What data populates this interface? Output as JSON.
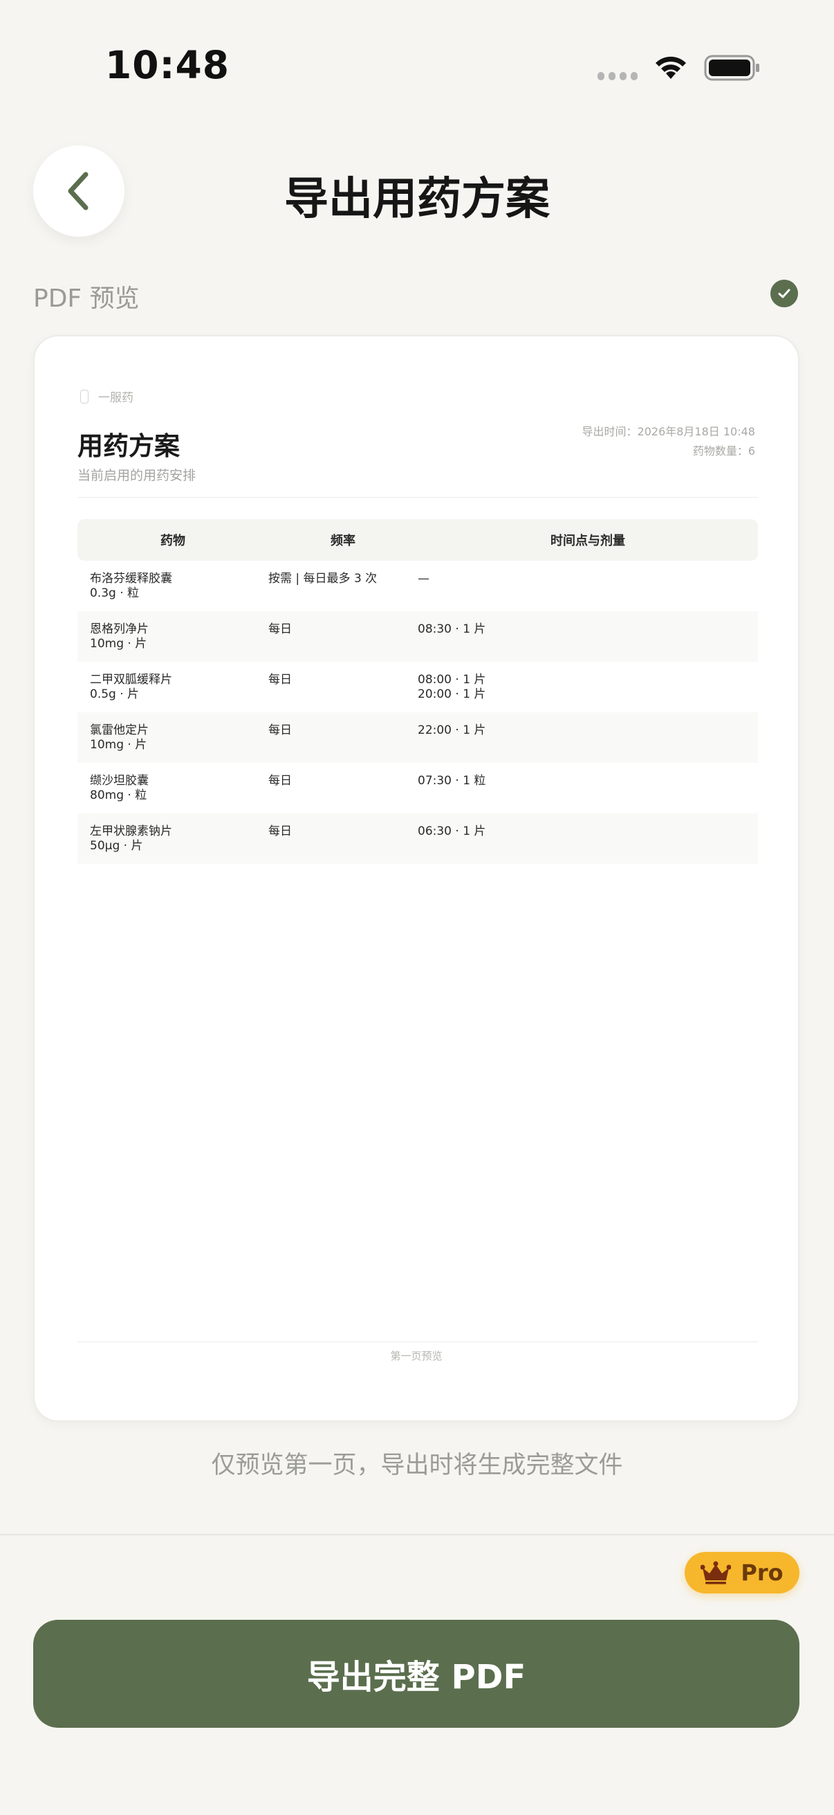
{
  "status_bar": {
    "time": "10:48"
  },
  "header": {
    "title": "导出用药方案",
    "back_icon": "chevron-left-icon"
  },
  "section": {
    "label": "PDF 预览",
    "check_icon": "check-circle-icon"
  },
  "document": {
    "brand": "一服药",
    "title": "用药方案",
    "subtitle": "当前启用的用药安排",
    "export_time": "导出时间：2026年8月18日 10:48",
    "med_count": "药物数量：6",
    "columns": [
      "药物",
      "频率",
      "时间点与剂量"
    ],
    "rows": [
      {
        "name": "布洛芬缓释胶囊",
        "dose": "0.3g · 粒",
        "frequency": "按需 | 每日最多 3 次",
        "times": [
          "—"
        ]
      },
      {
        "name": "恩格列净片",
        "dose": "10mg · 片",
        "frequency": "每日",
        "times": [
          "08:30 · 1 片"
        ]
      },
      {
        "name": "二甲双胍缓释片",
        "dose": "0.5g · 片",
        "frequency": "每日",
        "times": [
          "08:00 · 1 片",
          "20:00 · 1 片"
        ]
      },
      {
        "name": "氯雷他定片",
        "dose": "10mg · 片",
        "frequency": "每日",
        "times": [
          "22:00 · 1 片"
        ]
      },
      {
        "name": "缬沙坦胶囊",
        "dose": "80mg · 粒",
        "frequency": "每日",
        "times": [
          "07:30 · 1 粒"
        ]
      },
      {
        "name": "左甲状腺素钠片",
        "dose": "50μg · 片",
        "frequency": "每日",
        "times": [
          "06:30 · 1 片"
        ]
      }
    ],
    "footer": "第一页预览"
  },
  "preview_note": "仅预览第一页，导出时将生成完整文件",
  "pro_badge": {
    "label": "Pro",
    "icon": "crown-icon",
    "color": "#f7b72c"
  },
  "export_button": {
    "label": "导出完整 PDF",
    "color": "#5b6e4e"
  }
}
